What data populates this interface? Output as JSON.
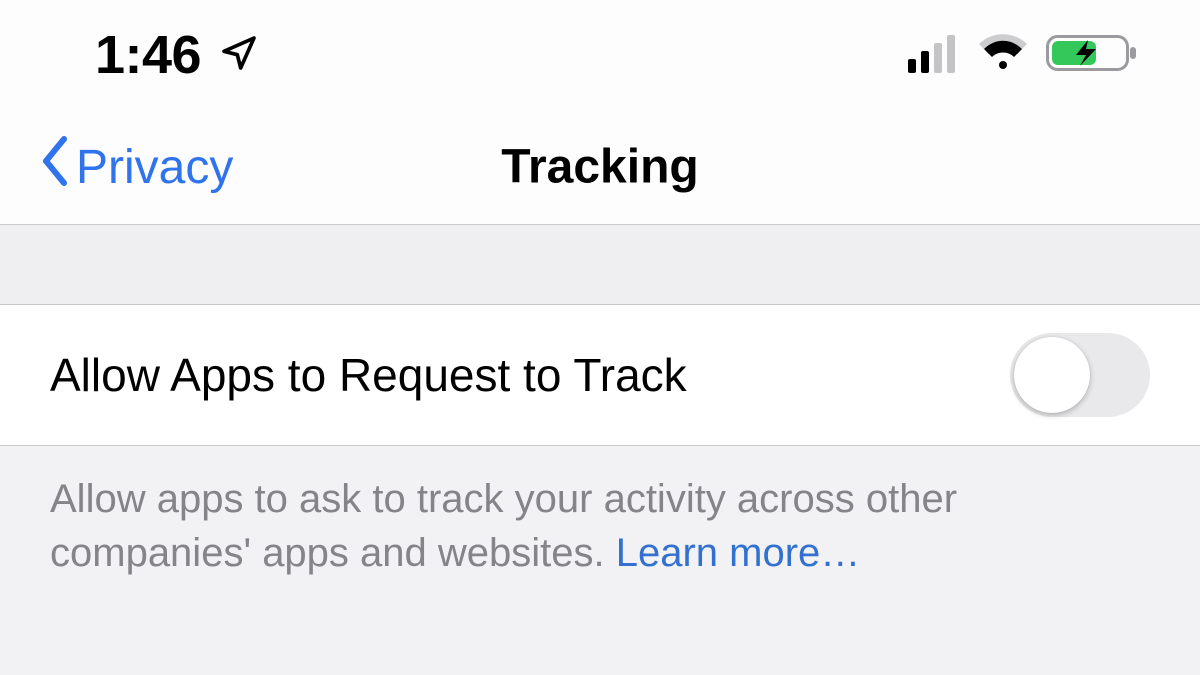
{
  "statusbar": {
    "time": "1:46"
  },
  "nav": {
    "back_label": "Privacy",
    "title": "Tracking"
  },
  "setting": {
    "label": "Allow Apps to Request to Track",
    "enabled": false
  },
  "footer": {
    "text": "Allow apps to ask to track your activity across other companies' apps and websites. ",
    "learn_more": "Learn more…"
  },
  "colors": {
    "link": "#2f73ed",
    "bg_group": "#efeff1",
    "border": "#c9c9cc",
    "toggle_off_track": "#e9e9eb"
  }
}
